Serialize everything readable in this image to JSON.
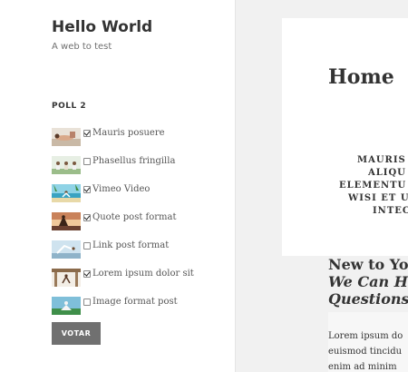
{
  "site": {
    "title": "Hello World",
    "description": "A web to test"
  },
  "poll": {
    "title": "POLL 2",
    "options": [
      {
        "label": "Mauris posuere",
        "checked": true
      },
      {
        "label": "Phasellus fringilla",
        "checked": false
      },
      {
        "label": "Vimeo Video",
        "checked": true
      },
      {
        "label": "Quote post format",
        "checked": true
      },
      {
        "label": "Link post format",
        "checked": false
      },
      {
        "label": "Lorem ipsum dolor sit",
        "checked": true
      },
      {
        "label": "Image format post",
        "checked": false
      }
    ],
    "vote_label": "VOTAR"
  },
  "main": {
    "page_title": "Home",
    "centered_lines": [
      "MAURIS",
      "ALIQU",
      "ELEMENTU",
      "WISI ET U",
      "INTEC"
    ],
    "section_heading": "New to Yog",
    "section_heading_italic": [
      "We Can He",
      "Questions"
    ],
    "paragraph_lines": [
      "Lorem ipsum do",
      "euismod tincidu",
      "enim ad minim"
    ]
  }
}
